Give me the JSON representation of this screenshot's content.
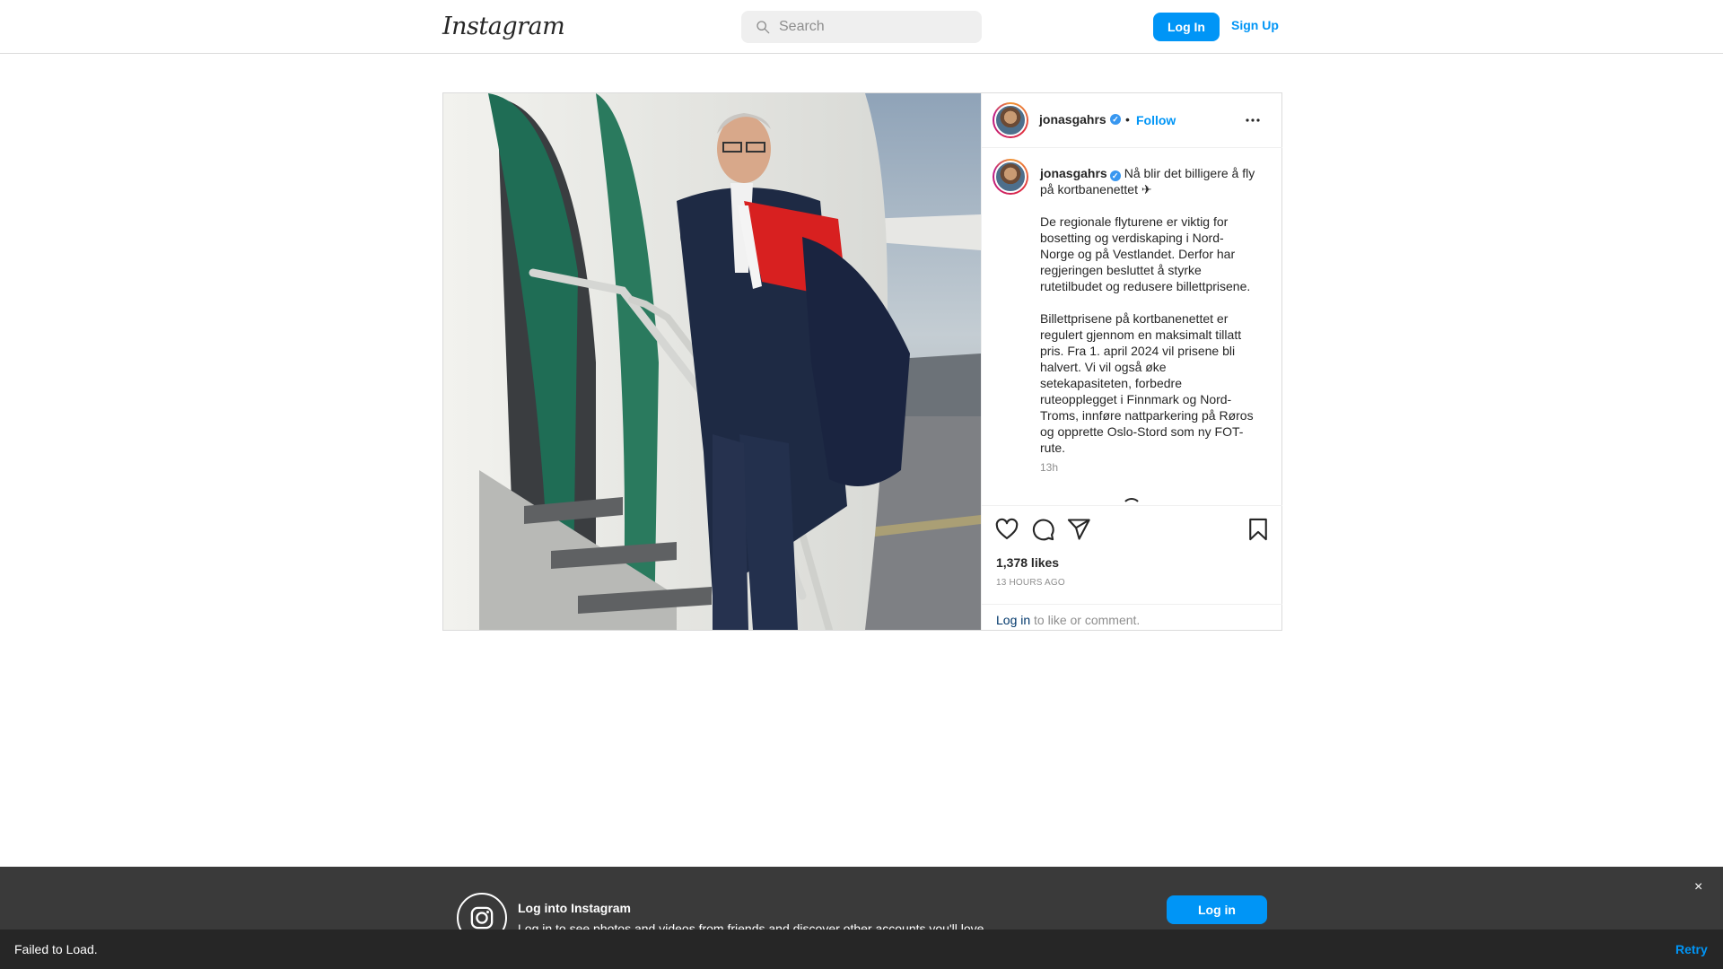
{
  "header": {
    "logo_text": "Instagram",
    "search_placeholder": "Search",
    "login_label": "Log In",
    "signup_label": "Sign Up"
  },
  "post": {
    "username": "jonasgahrs",
    "verified": true,
    "separator": "•",
    "follow_label": "Follow",
    "caption_first": "Nå blir det billigere å fly på kortbanenettet ✈",
    "caption_p2": "De regionale flyturene er viktig for bosetting og verdiskaping i Nord-Norge og på Vestlandet. Derfor har regjeringen besluttet å styrke rutetilbudet og redusere billettprisene.",
    "caption_p3": "Billettprisene på kortbanenettet er regulert gjennom en maksimalt tillatt pris. Fra 1. april 2024 vil prisene bli halvert. Vi vil også øke setekapasiteten, forbedre ruteopplegget i Finnmark og Nord-Troms, innføre nattparkering på Røros og opprette Oslo-Stord som ny FOT-rute.",
    "caption_time": "13h",
    "likes": "1,378 likes",
    "posted_ago": "13 HOURS AGO",
    "login_link": "Log in",
    "login_suffix": " to like or comment."
  },
  "banner": {
    "title": "Log into Instagram",
    "text": "Log in to see photos and videos from friends and discover other accounts you'll love.",
    "login_label": "Log in",
    "close_glyph": "×"
  },
  "failbar": {
    "message": "Failed to Load.",
    "retry_label": "Retry"
  },
  "colors": {
    "accent": "#0095f6",
    "verified": "#3897f0",
    "banner_bg": "#3a3a3a",
    "failbar_bg": "#262626"
  }
}
